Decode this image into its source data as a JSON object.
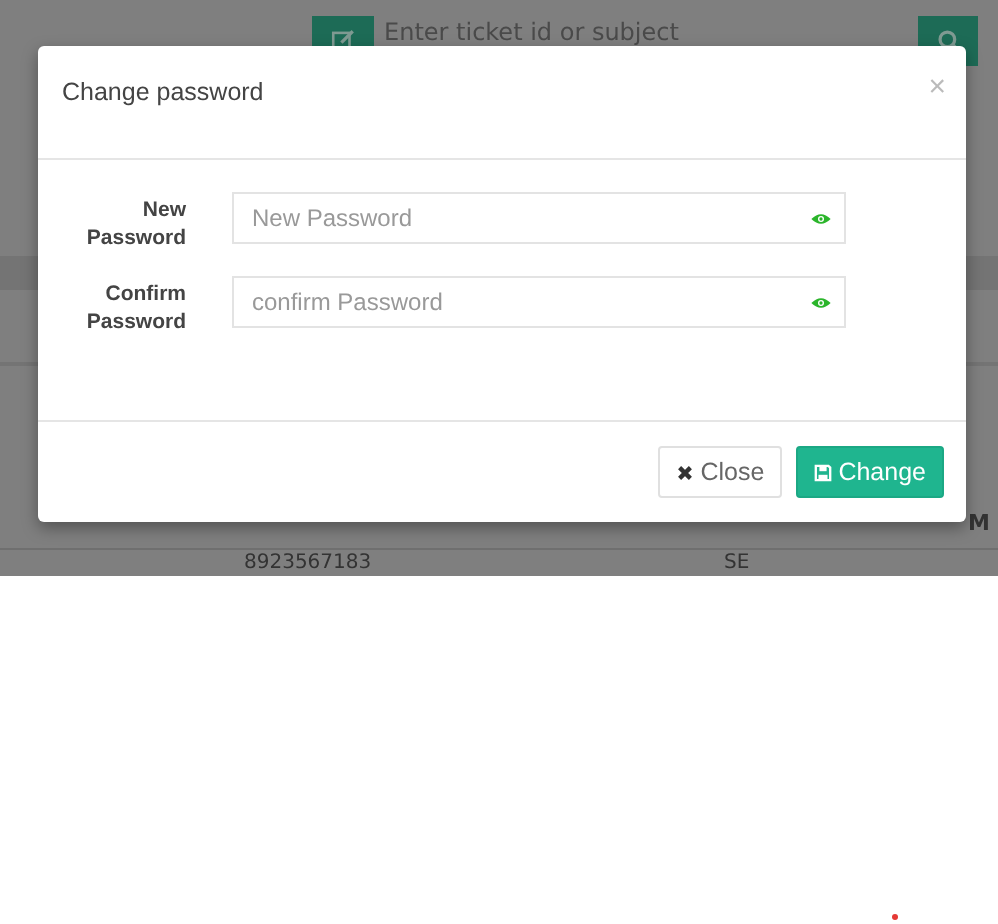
{
  "background": {
    "search": {
      "placeholder": "Enter ticket id or subject"
    },
    "table": {
      "header_tail": "M",
      "rows": [
        {
          "column_1": "8923567183",
          "column_2": "SE"
        }
      ]
    }
  },
  "dialog": {
    "title": "Change password",
    "close_symbol": "×",
    "fields": [
      {
        "label": "New Password",
        "placeholder": "New Password"
      },
      {
        "label": "Confirm Password",
        "placeholder": "confirm Password"
      }
    ],
    "buttons": [
      {
        "label": "Close",
        "kind": "close"
      },
      {
        "label": "Change",
        "kind": "primary"
      }
    ]
  },
  "marker": {
    "color": "#e53935"
  }
}
